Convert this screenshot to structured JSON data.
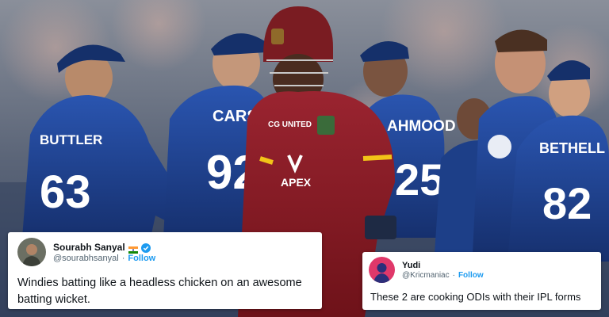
{
  "photo": {
    "player_name": "",
    "batsman_sponsor_top": "CG UNITED",
    "batsman_sponsor_main": "APEX",
    "fielders": [
      {
        "name": "BUTTLER",
        "number": "63"
      },
      {
        "name": "CARSE",
        "number": "92"
      },
      {
        "name": "AHMOOD",
        "number": "25"
      },
      {
        "name": "BETHELL",
        "number": "82"
      }
    ]
  },
  "tweets": [
    {
      "display_name": "Sourabh Sanyal",
      "flag": "india-flag-icon",
      "verified": true,
      "handle": "@sourabhsanyal",
      "separator": "·",
      "follow_label": "Follow",
      "text": "Windies batting like a headless chicken on an awesome batting wicket."
    },
    {
      "display_name": "Yudi",
      "handle": "@Kricmaniac",
      "separator": "·",
      "follow_label": "Follow",
      "text": "These 2 are cooking ODIs with their IPL forms"
    }
  ],
  "colors": {
    "england_kit": "#1f3f8a",
    "windies_kit": "#8a1c24",
    "twitter_blue": "#1d9bf0"
  }
}
